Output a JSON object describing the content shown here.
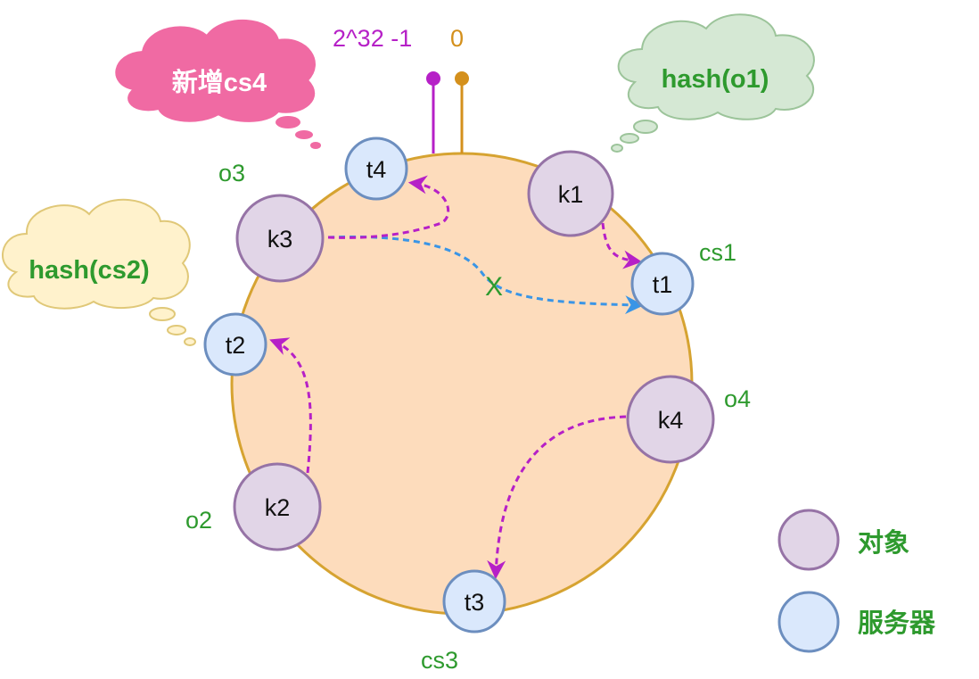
{
  "ring": {
    "max_label": "2^32 -1",
    "zero_label": "0"
  },
  "clouds": {
    "new_server": "新增cs4",
    "hash_object": "hash(o1)",
    "hash_server": "hash(cs2)"
  },
  "objects": {
    "k1": "k1",
    "k2": "k2",
    "k3": "k3",
    "k4": "k4"
  },
  "object_names": {
    "o2": "o2",
    "o3": "o3",
    "o4": "o4"
  },
  "servers": {
    "t1": "t1",
    "t2": "t2",
    "t3": "t3",
    "t4": "t4"
  },
  "server_names": {
    "cs1": "cs1",
    "cs3": "cs3"
  },
  "invalid_mark": "X",
  "legend": {
    "object_label": "对象",
    "server_label": "服务器"
  },
  "colors": {
    "ring_fill": "#fddcbc",
    "ring_stroke": "#d6a331",
    "object_fill": "#e1d5e7",
    "object_stroke": "#9673a6",
    "server_fill": "#dae8fc",
    "server_stroke": "#6c8ebf",
    "magenta": "#b620c7",
    "blue": "#3a95e6",
    "green": "#2e9a2e",
    "orange": "#d4901c",
    "cloud_pink": "#f06aa3",
    "cloud_green": "#d5e8d4",
    "cloud_yellow": "#fff2cc"
  }
}
